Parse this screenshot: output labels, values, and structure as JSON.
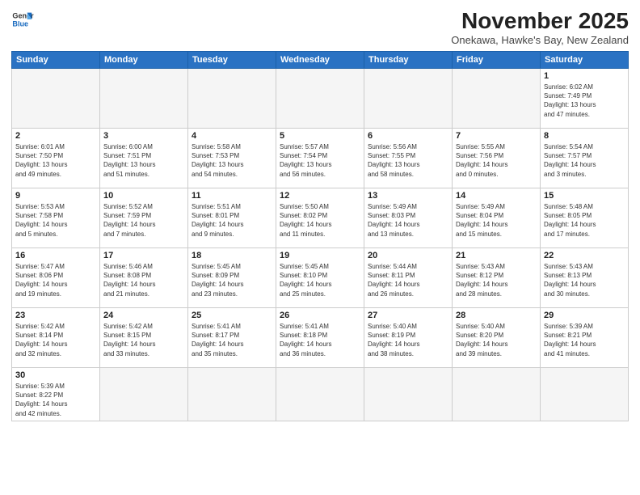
{
  "logo": {
    "line1": "General",
    "line2": "Blue"
  },
  "title": "November 2025",
  "subtitle": "Onekawa, Hawke's Bay, New Zealand",
  "weekdays": [
    "Sunday",
    "Monday",
    "Tuesday",
    "Wednesday",
    "Thursday",
    "Friday",
    "Saturday"
  ],
  "weeks": [
    [
      {
        "day": "",
        "info": ""
      },
      {
        "day": "",
        "info": ""
      },
      {
        "day": "",
        "info": ""
      },
      {
        "day": "",
        "info": ""
      },
      {
        "day": "",
        "info": ""
      },
      {
        "day": "",
        "info": ""
      },
      {
        "day": "1",
        "info": "Sunrise: 6:02 AM\nSunset: 7:49 PM\nDaylight: 13 hours\nand 47 minutes."
      }
    ],
    [
      {
        "day": "2",
        "info": "Sunrise: 6:01 AM\nSunset: 7:50 PM\nDaylight: 13 hours\nand 49 minutes."
      },
      {
        "day": "3",
        "info": "Sunrise: 6:00 AM\nSunset: 7:51 PM\nDaylight: 13 hours\nand 51 minutes."
      },
      {
        "day": "4",
        "info": "Sunrise: 5:58 AM\nSunset: 7:53 PM\nDaylight: 13 hours\nand 54 minutes."
      },
      {
        "day": "5",
        "info": "Sunrise: 5:57 AM\nSunset: 7:54 PM\nDaylight: 13 hours\nand 56 minutes."
      },
      {
        "day": "6",
        "info": "Sunrise: 5:56 AM\nSunset: 7:55 PM\nDaylight: 13 hours\nand 58 minutes."
      },
      {
        "day": "7",
        "info": "Sunrise: 5:55 AM\nSunset: 7:56 PM\nDaylight: 14 hours\nand 0 minutes."
      },
      {
        "day": "8",
        "info": "Sunrise: 5:54 AM\nSunset: 7:57 PM\nDaylight: 14 hours\nand 3 minutes."
      }
    ],
    [
      {
        "day": "9",
        "info": "Sunrise: 5:53 AM\nSunset: 7:58 PM\nDaylight: 14 hours\nand 5 minutes."
      },
      {
        "day": "10",
        "info": "Sunrise: 5:52 AM\nSunset: 7:59 PM\nDaylight: 14 hours\nand 7 minutes."
      },
      {
        "day": "11",
        "info": "Sunrise: 5:51 AM\nSunset: 8:01 PM\nDaylight: 14 hours\nand 9 minutes."
      },
      {
        "day": "12",
        "info": "Sunrise: 5:50 AM\nSunset: 8:02 PM\nDaylight: 14 hours\nand 11 minutes."
      },
      {
        "day": "13",
        "info": "Sunrise: 5:49 AM\nSunset: 8:03 PM\nDaylight: 14 hours\nand 13 minutes."
      },
      {
        "day": "14",
        "info": "Sunrise: 5:49 AM\nSunset: 8:04 PM\nDaylight: 14 hours\nand 15 minutes."
      },
      {
        "day": "15",
        "info": "Sunrise: 5:48 AM\nSunset: 8:05 PM\nDaylight: 14 hours\nand 17 minutes."
      }
    ],
    [
      {
        "day": "16",
        "info": "Sunrise: 5:47 AM\nSunset: 8:06 PM\nDaylight: 14 hours\nand 19 minutes."
      },
      {
        "day": "17",
        "info": "Sunrise: 5:46 AM\nSunset: 8:08 PM\nDaylight: 14 hours\nand 21 minutes."
      },
      {
        "day": "18",
        "info": "Sunrise: 5:45 AM\nSunset: 8:09 PM\nDaylight: 14 hours\nand 23 minutes."
      },
      {
        "day": "19",
        "info": "Sunrise: 5:45 AM\nSunset: 8:10 PM\nDaylight: 14 hours\nand 25 minutes."
      },
      {
        "day": "20",
        "info": "Sunrise: 5:44 AM\nSunset: 8:11 PM\nDaylight: 14 hours\nand 26 minutes."
      },
      {
        "day": "21",
        "info": "Sunrise: 5:43 AM\nSunset: 8:12 PM\nDaylight: 14 hours\nand 28 minutes."
      },
      {
        "day": "22",
        "info": "Sunrise: 5:43 AM\nSunset: 8:13 PM\nDaylight: 14 hours\nand 30 minutes."
      }
    ],
    [
      {
        "day": "23",
        "info": "Sunrise: 5:42 AM\nSunset: 8:14 PM\nDaylight: 14 hours\nand 32 minutes."
      },
      {
        "day": "24",
        "info": "Sunrise: 5:42 AM\nSunset: 8:15 PM\nDaylight: 14 hours\nand 33 minutes."
      },
      {
        "day": "25",
        "info": "Sunrise: 5:41 AM\nSunset: 8:17 PM\nDaylight: 14 hours\nand 35 minutes."
      },
      {
        "day": "26",
        "info": "Sunrise: 5:41 AM\nSunset: 8:18 PM\nDaylight: 14 hours\nand 36 minutes."
      },
      {
        "day": "27",
        "info": "Sunrise: 5:40 AM\nSunset: 8:19 PM\nDaylight: 14 hours\nand 38 minutes."
      },
      {
        "day": "28",
        "info": "Sunrise: 5:40 AM\nSunset: 8:20 PM\nDaylight: 14 hours\nand 39 minutes."
      },
      {
        "day": "29",
        "info": "Sunrise: 5:39 AM\nSunset: 8:21 PM\nDaylight: 14 hours\nand 41 minutes."
      }
    ],
    [
      {
        "day": "30",
        "info": "Sunrise: 5:39 AM\nSunset: 8:22 PM\nDaylight: 14 hours\nand 42 minutes."
      },
      {
        "day": "",
        "info": ""
      },
      {
        "day": "",
        "info": ""
      },
      {
        "day": "",
        "info": ""
      },
      {
        "day": "",
        "info": ""
      },
      {
        "day": "",
        "info": ""
      },
      {
        "day": "",
        "info": ""
      }
    ]
  ]
}
